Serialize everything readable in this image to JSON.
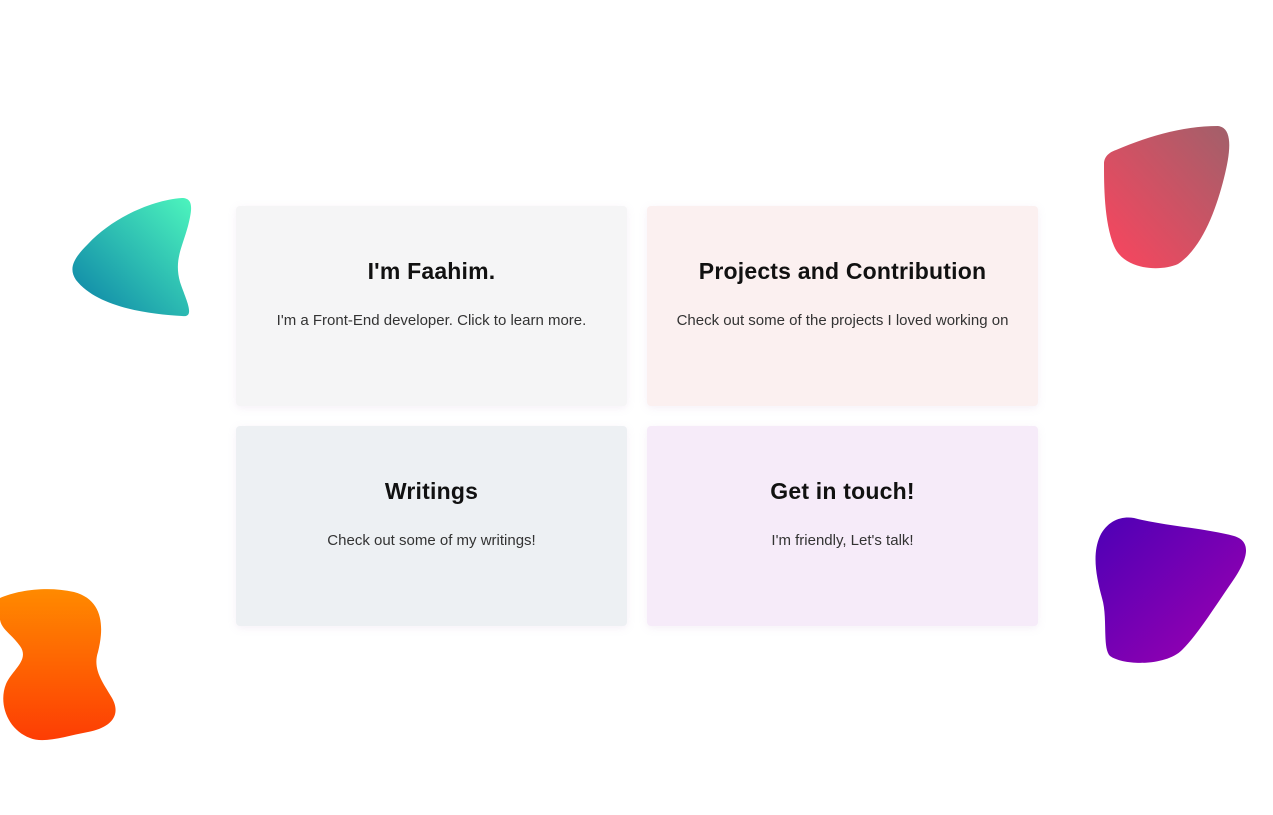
{
  "cards": [
    {
      "title": "I'm Faahim.",
      "description": "I'm a Front-End developer. Click to learn more.",
      "background": "#f5f5f6"
    },
    {
      "title": "Projects and Contribution",
      "description": "Check out some of the projects I loved working on",
      "background": "#fbf0f0"
    },
    {
      "title": "Writings",
      "description": "Check out some of my writings!",
      "background": "#edf0f3"
    },
    {
      "title": "Get in touch!",
      "description": "I'm friendly, Let's talk!",
      "background": "#f6ebf9"
    }
  ],
  "decorations": {
    "teal_blob": {
      "from": "#4df5bd",
      "to": "#0a7fa6"
    },
    "red_blob": {
      "from": "#a1606a",
      "to": "#fc445e"
    },
    "orange_blob": {
      "from": "#ff8a00",
      "to": "#fd3d04"
    },
    "purple_blob": {
      "from": "#4d00b6",
      "to": "#a000b0"
    }
  }
}
